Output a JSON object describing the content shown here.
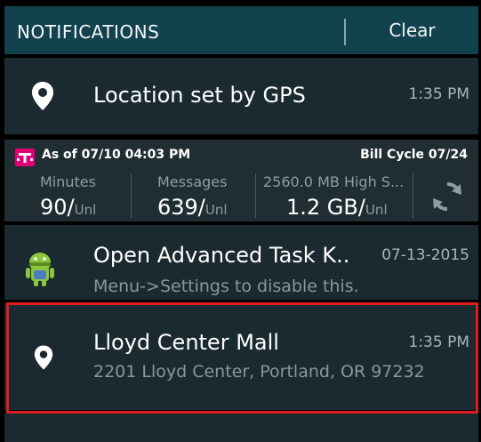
{
  "header": {
    "title": "NOTIFICATIONS",
    "clear_label": "Clear"
  },
  "gps_notification": {
    "icon": "location-pin-icon",
    "title": "Location set by GPS",
    "time": "1:35 PM"
  },
  "carrier_widget": {
    "logo": "t-mobile-logo",
    "as_of": "As of  07/10 04:03 PM",
    "bill_cycle": "Bill Cycle 07/24",
    "stats": [
      {
        "label": "Minutes",
        "value": "90/",
        "unit": "Unl"
      },
      {
        "label": "Messages",
        "value": "639/",
        "unit": "Unl"
      },
      {
        "label": "2560.0 MB High S...",
        "value": "1.2 GB/",
        "unit": "Unl"
      }
    ],
    "refresh_icon": "refresh-icon"
  },
  "task_notification": {
    "icon": "android-task-killer-icon",
    "title": "Open Advanced Task K..",
    "date": "07-13-2015",
    "subtitle": "Menu->Settings to disable this."
  },
  "location_notification": {
    "icon": "location-pin-icon",
    "title": "Lloyd Center Mall",
    "time": "1:35 PM",
    "subtitle": "2201 Lloyd Center, Portland, OR 97232"
  },
  "colors": {
    "header_bg": "#13424f",
    "card_bg": "#1a2a30",
    "highlight": "#e01d1d"
  }
}
